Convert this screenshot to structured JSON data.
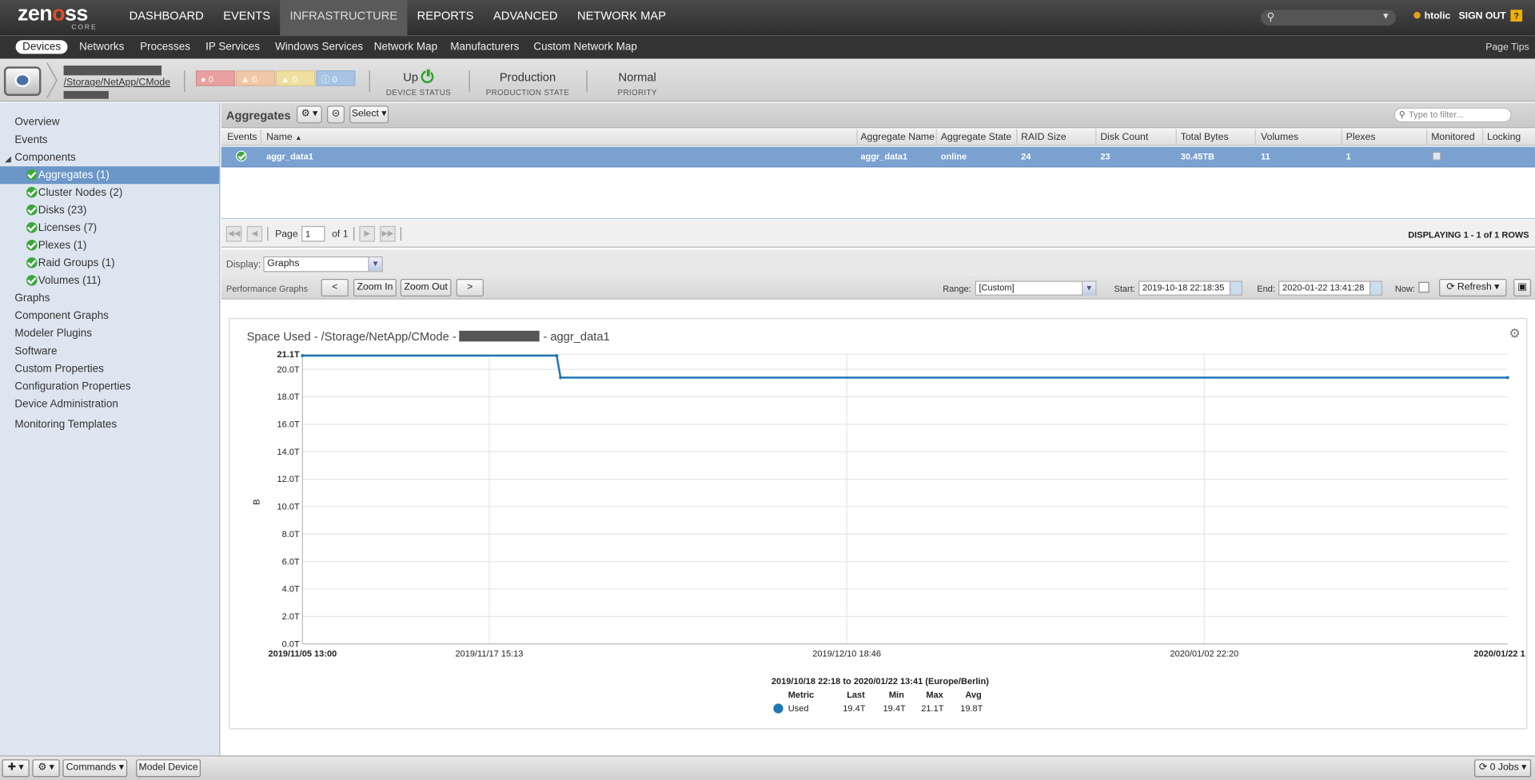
{
  "logo": {
    "word_before": "zen",
    "word_o": "o",
    "word_after": "ss",
    "sub": "CORE"
  },
  "mainnav": [
    "DASHBOARD",
    "EVENTS",
    "INFRASTRUCTURE",
    "REPORTS",
    "ADVANCED",
    "NETWORK MAP"
  ],
  "user": {
    "name": "htolic",
    "signout": "SIGN OUT",
    "help": "?"
  },
  "subnav": {
    "items": [
      "Devices",
      "Networks",
      "Processes",
      "IP Services",
      "Windows Services",
      "Network Map",
      "Manufacturers",
      "Custom Network Map"
    ],
    "tips": "Page Tips"
  },
  "device": {
    "path": "/Storage/NetApp/CMode",
    "events": [
      "0",
      "0",
      "0",
      "0"
    ],
    "status": "Up",
    "status_label": "DEVICE STATUS",
    "production": "Production",
    "production_label": "PRODUCTION STATE",
    "priority": "Normal",
    "priority_label": "PRIORITY"
  },
  "sidebar": {
    "top": [
      "Overview",
      "Events"
    ],
    "components_label": "Components",
    "components": [
      "Aggregates (1)",
      "Cluster Nodes (2)",
      "Disks (23)",
      "Licenses (7)",
      "Plexes (1)",
      "Raid Groups (1)",
      "Volumes (11)"
    ],
    "bottom": [
      "Graphs",
      "Component Graphs",
      "Modeler Plugins",
      "Software",
      "Custom Properties",
      "Configuration Properties",
      "Device Administration"
    ],
    "templates": "Monitoring Templates"
  },
  "aggregates": {
    "title": "Aggregates",
    "select": "Select",
    "filter_placeholder": "Type to filter...",
    "columns": [
      "Events",
      "Name",
      "Aggregate Name",
      "Aggregate State",
      "RAID Size",
      "Disk Count",
      "Total Bytes",
      "Volumes",
      "Plexes",
      "Monitored",
      "Locking"
    ],
    "row": {
      "name": "aggr_data1",
      "aggregate_name": "aggr_data1",
      "state": "online",
      "raid_size": "24",
      "disk_count": "23",
      "total_bytes": "30.45TB",
      "volumes": "11",
      "plexes": "1"
    }
  },
  "pager": {
    "page_label": "Page",
    "page": "1",
    "of": "of 1",
    "displaying": "DISPLAYING 1 - 1 of 1 ROWS"
  },
  "display": {
    "label": "Display:",
    "value": "Graphs"
  },
  "perf": {
    "label": "Performance Graphs",
    "prev": "<",
    "zoom_in": "Zoom In",
    "zoom_out": "Zoom Out",
    "next": ">",
    "range_label": "Range:",
    "range": "[Custom]",
    "start_label": "Start:",
    "start": "2019-10-18 22:18:35",
    "end_label": "End:",
    "end": "2020-01-22 13:41:28",
    "now_label": "Now:",
    "refresh": "Refresh"
  },
  "graph": {
    "title_before": "Space Used - /Storage/NetApp/CMode -",
    "title_after": "- aggr_data1",
    "legend_range": "2019/10/18 22:18 to 2020/01/22 13:41 (Europe/Berlin)",
    "legend_headers": [
      "Metric",
      "Last",
      "Min",
      "Max",
      "Avg"
    ],
    "legend_values": [
      "Used",
      "19.4T",
      "19.4T",
      "21.1T",
      "19.8T"
    ]
  },
  "chart_data": {
    "type": "line",
    "ylabel": "B",
    "ylim": [
      0,
      21.1
    ],
    "y_ticks": [
      "0.0T",
      "2.0T",
      "4.0T",
      "6.0T",
      "8.0T",
      "10.0T",
      "12.0T",
      "14.0T",
      "16.0T",
      "18.0T",
      "20.0T",
      "21.1T"
    ],
    "x_ticks": [
      "2019/11/05 13:00",
      "2019/11/17 15:13",
      "2019/12/10 18:46",
      "2020/01/02 22:20",
      "2020/01/22 1"
    ],
    "series": [
      {
        "name": "Used",
        "color": "#1f77b4",
        "x": [
          "2019/11/05 13:00",
          "2019/11/22 00:00",
          "2019/11/22 06:00",
          "2020/01/22 13:41"
        ],
        "values": [
          21.0,
          21.0,
          19.4,
          19.4
        ]
      }
    ]
  },
  "bottombar": {
    "commands": "Commands",
    "model": "Model Device",
    "jobs": "0 Jobs"
  },
  "colors": {
    "accent": "#7aa1d0",
    "sidebar_bg": "#dde6f0",
    "topnav": "#3a3a3a",
    "series": "#1f77b4"
  }
}
